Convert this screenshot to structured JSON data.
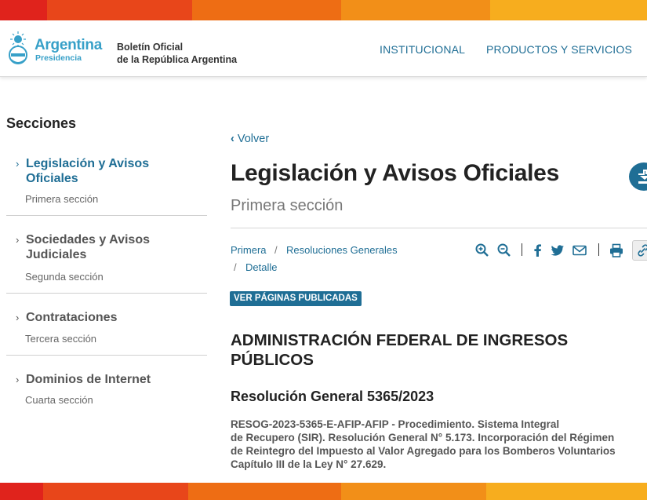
{
  "brand": {
    "name": "Argentina",
    "subname": "Presidencia",
    "site_title_line1": "Boletín Oficial",
    "site_title_line2": "de la República Argentina"
  },
  "nav": {
    "items": [
      "INSTITUCIONAL",
      "PRODUCTOS Y SERVICIOS"
    ]
  },
  "colors": {
    "accent_blue": "#1f6e95",
    "logo_blue": "#37a0c8",
    "strip": [
      "#e0231c",
      "#eb5a14",
      "#f39a1a",
      "#f7b21e"
    ]
  },
  "sidebar": {
    "heading": "Secciones",
    "items": [
      {
        "title": "Legislación y Avisos Oficiales",
        "subtitle": "Primera sección",
        "active": true
      },
      {
        "title": "Sociedades y Avisos Judiciales",
        "subtitle": "Segunda sección",
        "active": false
      },
      {
        "title": "Contrataciones",
        "subtitle": "Tercera sección",
        "active": false
      },
      {
        "title": "Dominios de Internet",
        "subtitle": "Cuarta sección",
        "active": false
      }
    ]
  },
  "main": {
    "back_label": "Volver",
    "title": "Legislación y Avisos Oficiales",
    "subtitle": "Primera sección",
    "breadcrumb": [
      "Primera",
      "Resoluciones Generales",
      "Detalle"
    ],
    "breadcrumb_separator": "/",
    "toolbar_icons": [
      "zoom-in-icon",
      "zoom-out-icon",
      "facebook-icon",
      "twitter-icon",
      "email-icon",
      "print-icon",
      "link-icon"
    ],
    "pages_badge": "VER PÁGINAS PUBLICADAS",
    "organization": "ADMINISTRACIÓN FEDERAL DE INGRESOS PÚBLICOS",
    "resolution_title": "Resolución General 5365/2023",
    "resolution_summary_lines": [
      "RESOG-2023-5365-E-AFIP-AFIP - Procedimiento. Sistema Integral",
      "de Recupero (SIR). Resolución General N° 5.173. Incorporación del Régimen",
      "de Reintegro del Impuesto al Valor Agregado para los Bomberos Voluntarios",
      "Capítulo III de la Ley N° 27.629."
    ]
  }
}
